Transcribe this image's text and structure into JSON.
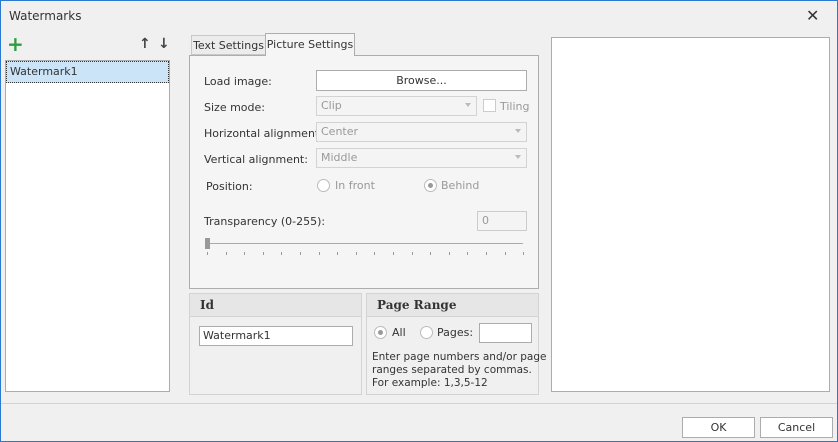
{
  "window": {
    "title": "Watermarks"
  },
  "list": {
    "items": [
      "Watermark1"
    ]
  },
  "tabs": [
    "Text Settings",
    "Picture Settings"
  ],
  "picture": {
    "load_image_label": "Load image:",
    "browse_label": "Browse...",
    "size_mode_label": "Size mode:",
    "size_mode_value": "Clip",
    "tiling_label": "Tiling",
    "h_align_label": "Horizontal alignment:",
    "h_align_value": "Center",
    "v_align_label": "Vertical alignment:",
    "v_align_value": "Middle",
    "position_label": "Position:",
    "position_options": [
      "In front",
      "Behind"
    ],
    "transparency_label": "Transparency (0-255):",
    "transparency_value": "0"
  },
  "id_group": {
    "title": "Id",
    "value": "Watermark1"
  },
  "page_range": {
    "title": "Page Range",
    "all_label": "All",
    "pages_label": "Pages:",
    "pages_value": "",
    "hint": [
      "Enter page numbers and/or page",
      "ranges separated by commas.",
      "For example: 1,3,5-12"
    ]
  },
  "footer": {
    "ok": "OK",
    "cancel": "Cancel"
  }
}
